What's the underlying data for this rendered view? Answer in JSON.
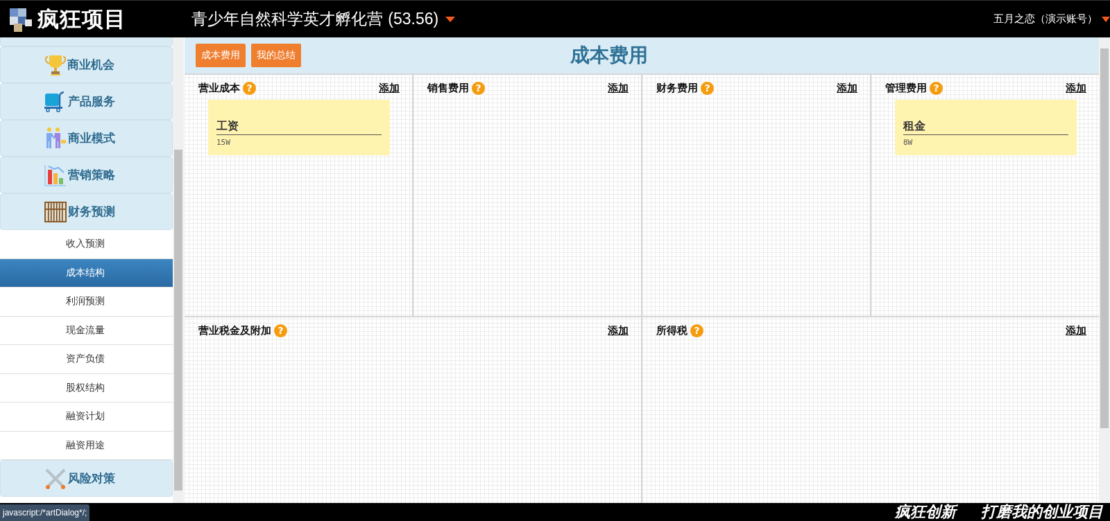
{
  "header": {
    "logo_text": "疯狂项目",
    "project_title": "青少年自然科学英才孵化营",
    "score": "(53.56)",
    "user": "五月之恋（演示账号）"
  },
  "sidebar": {
    "items": [
      {
        "kind": "group",
        "label": "商业机会",
        "selected": false
      },
      {
        "kind": "group",
        "label": "产品服务",
        "selected": false
      },
      {
        "kind": "group",
        "label": "商业模式",
        "selected": false
      },
      {
        "kind": "group",
        "label": "营销策略",
        "selected": false
      },
      {
        "kind": "group",
        "label": "财务预测",
        "selected": false
      },
      {
        "kind": "sub",
        "label": "收入预测",
        "selected": false
      },
      {
        "kind": "sub",
        "label": "成本结构",
        "selected": true
      },
      {
        "kind": "sub",
        "label": "利润预测",
        "selected": false
      },
      {
        "kind": "sub",
        "label": "现金流量",
        "selected": false
      },
      {
        "kind": "sub",
        "label": "资产负债",
        "selected": false
      },
      {
        "kind": "sub",
        "label": "股权结构",
        "selected": false
      },
      {
        "kind": "sub",
        "label": "融资计划",
        "selected": false
      },
      {
        "kind": "sub",
        "label": "融资用途",
        "selected": false
      },
      {
        "kind": "group",
        "label": "风险对策",
        "selected": false
      }
    ]
  },
  "toolbar": {
    "buttons": [
      "成本费用",
      "我的总结"
    ],
    "page_title": "成本费用"
  },
  "panel_rows": [
    [
      {
        "title": "营业成本",
        "help": "?",
        "add_label": "添加",
        "notes": [
          {
            "title": "工资",
            "amount": "15W"
          }
        ]
      },
      {
        "title": "销售费用",
        "help": "?",
        "add_label": "添加"
      },
      {
        "title": "财务费用",
        "help": "?",
        "add_label": "添加"
      },
      {
        "title": "管理费用",
        "help": "?",
        "add_label": "添加",
        "notes": [
          {
            "title": "租金",
            "amount": "8W"
          }
        ]
      }
    ],
    [
      {
        "title": "营业税金及附加",
        "help": "?",
        "add_label": "添加"
      },
      {
        "title": "所得税",
        "help": "?",
        "add_label": "添加"
      }
    ]
  ],
  "status_link": "javascript:/*artDialog*/;",
  "footer": {
    "slogan_left": "疯狂创新",
    "slogan_right": "打磨我的创业项目"
  }
}
